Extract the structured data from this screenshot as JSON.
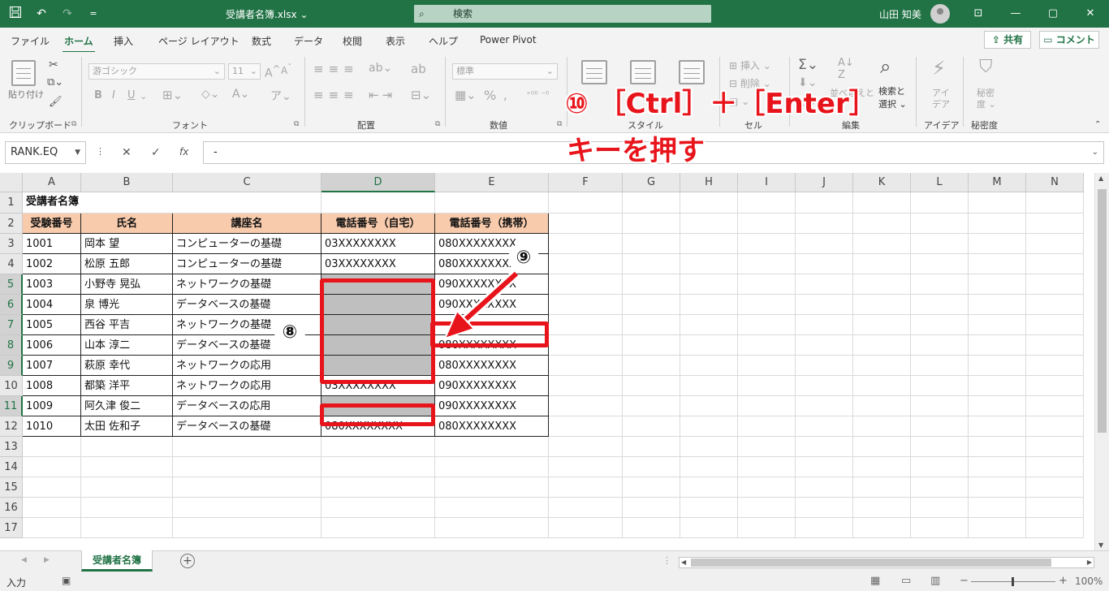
{
  "titlebar": {
    "filename": "受講者名簿.xlsx",
    "search": "検索",
    "user": "山田 知美",
    "qat_undo": "↶",
    "qat_redo": "↷",
    "qat_more": "=",
    "min": "—",
    "max": "▢",
    "close": "✕",
    "ribbon_toggle": "⊡"
  },
  "tabs": [
    "ファイル",
    "ホーム",
    "挿入",
    "ページ レイアウト",
    "数式",
    "データ",
    "校閲",
    "表示",
    "ヘルプ",
    "Power Pivot"
  ],
  "share": "共有",
  "comment": "コメント",
  "ribbon": {
    "groups": [
      "クリップボード",
      "フォント",
      "配置",
      "数値",
      "スタイル",
      "セル",
      "編集",
      "アイデア",
      "秘密度"
    ],
    "paste": "貼り付け",
    "font_name": "游ゴシック",
    "font_size": "11",
    "number_format": "標準",
    "insert": "挿入",
    "delete": "削除",
    "sort_filter": "並べ替えと",
    "find_select_1": "検索と",
    "find_select_2": "選択",
    "ideas_1": "アイ",
    "ideas_2": "デア",
    "sensitivity_1": "秘密",
    "sensitivity_2": "度"
  },
  "formula": {
    "namebox": "RANK.EQ",
    "value": "-",
    "cancel": "✕",
    "enter": "✓",
    "fx": "fx"
  },
  "columns": [
    "A",
    "B",
    "C",
    "D",
    "E",
    "F",
    "G",
    "H",
    "I",
    "J",
    "K",
    "L",
    "M",
    "N"
  ],
  "rows": [
    "1",
    "2",
    "3",
    "4",
    "5",
    "6",
    "7",
    "8",
    "9",
    "10",
    "11",
    "12",
    "13",
    "14",
    "15",
    "16",
    "17"
  ],
  "sheet": {
    "title": "受講者名簿",
    "headers": [
      "受験番号",
      "氏名",
      "講座名",
      "電話番号（自宅）",
      "電話番号（携帯）"
    ],
    "data": [
      [
        "1001",
        "岡本 望",
        "コンピューターの基礎",
        "03XXXXXXXX",
        "080XXXXXXXX"
      ],
      [
        "1002",
        "松原 五郎",
        "コンピューターの基礎",
        "03XXXXXXXX",
        "080XXXXXXXX"
      ],
      [
        "1003",
        "小野寺 晃弘",
        "ネットワークの基礎",
        "",
        "090XXXXXXXX"
      ],
      [
        "1004",
        "泉 博光",
        "データベースの基礎",
        "",
        "090XXXXXXXX"
      ],
      [
        "1005",
        "西谷 平吉",
        "ネットワークの基礎",
        "",
        "-"
      ],
      [
        "1006",
        "山本 淳二",
        "データベースの基礎",
        "",
        "080XXXXXXXX"
      ],
      [
        "1007",
        "萩原 幸代",
        "ネットワークの応用",
        "",
        "080XXXXXXXX"
      ],
      [
        "1008",
        "都築 洋平",
        "ネットワークの応用",
        "03XXXXXXXX",
        "090XXXXXXXX"
      ],
      [
        "1009",
        "阿久津 俊二",
        "データベースの応用",
        "",
        "090XXXXXXXX"
      ],
      [
        "1010",
        "太田 佐和子",
        "データベースの基礎",
        "080XXXXXXXX",
        "080XXXXXXXX"
      ]
    ]
  },
  "annotations": {
    "step8": "⑧",
    "step9": "⑨",
    "step10_line1": "⑩ ［Ctrl］＋［Enter］",
    "step10_line2": "キーを押す"
  },
  "status": {
    "mode": "入力",
    "zoom": "100%"
  },
  "colors": {
    "excel_green": "#217346",
    "header_fill": "#f8cbad",
    "selected_fill": "#bfbfbf",
    "annotation_red": "#e8141b"
  }
}
